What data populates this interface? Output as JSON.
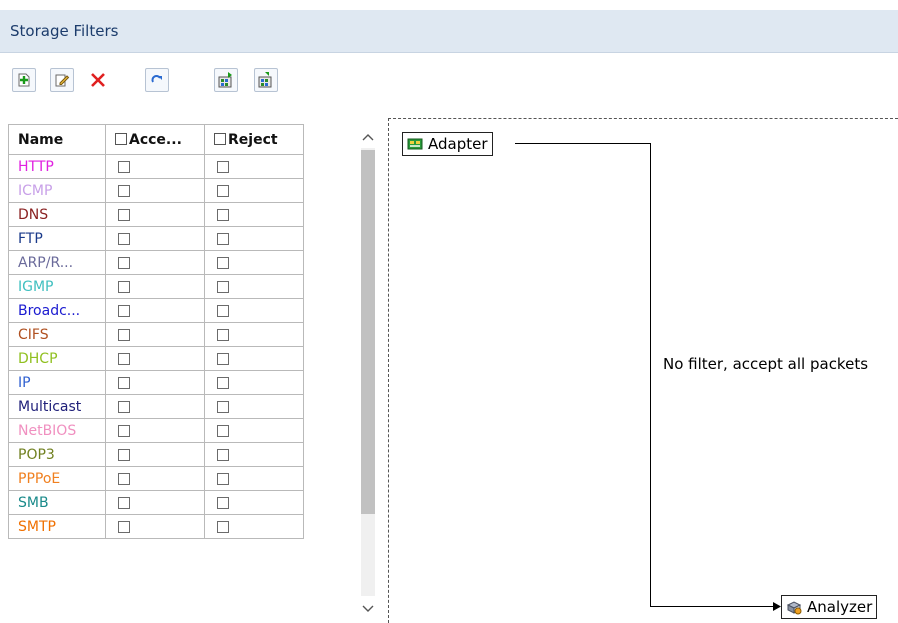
{
  "panel": {
    "title": "Storage Filters"
  },
  "toolbar": {
    "buttons": [
      {
        "icon": "add-filter-icon"
      },
      {
        "icon": "edit-icon"
      },
      {
        "icon": "delete-icon"
      },
      {
        "icon": "refresh-icon"
      },
      {
        "icon": "import-icon"
      },
      {
        "icon": "export-icon"
      }
    ]
  },
  "table": {
    "columns": {
      "name": "Name",
      "accept": "Acce...",
      "reject": "Reject"
    },
    "rows": [
      {
        "name": "HTTP",
        "color": "#e020e0"
      },
      {
        "name": "ICMP",
        "color": "#c8a0e8"
      },
      {
        "name": "DNS",
        "color": "#8a2222"
      },
      {
        "name": "FTP",
        "color": "#1a3a8a"
      },
      {
        "name": "ARP/R...",
        "color": "#6a6a9a"
      },
      {
        "name": "IGMP",
        "color": "#40c0c0"
      },
      {
        "name": "Broadc...",
        "color": "#1a1ad0"
      },
      {
        "name": "CIFS",
        "color": "#b05020"
      },
      {
        "name": "DHCP",
        "color": "#90c020"
      },
      {
        "name": "IP",
        "color": "#3060d0"
      },
      {
        "name": "Multicast",
        "color": "#20207a"
      },
      {
        "name": "NetBIOS",
        "color": "#f090c0"
      },
      {
        "name": "POP3",
        "color": "#708020"
      },
      {
        "name": "PPPoE",
        "color": "#f08020"
      },
      {
        "name": "SMB",
        "color": "#1a8a8a"
      },
      {
        "name": "SMTP",
        "color": "#f07000"
      }
    ]
  },
  "diagram": {
    "source_label": "Adapter",
    "target_label": "Analyzer",
    "message": "No filter, accept all packets"
  }
}
